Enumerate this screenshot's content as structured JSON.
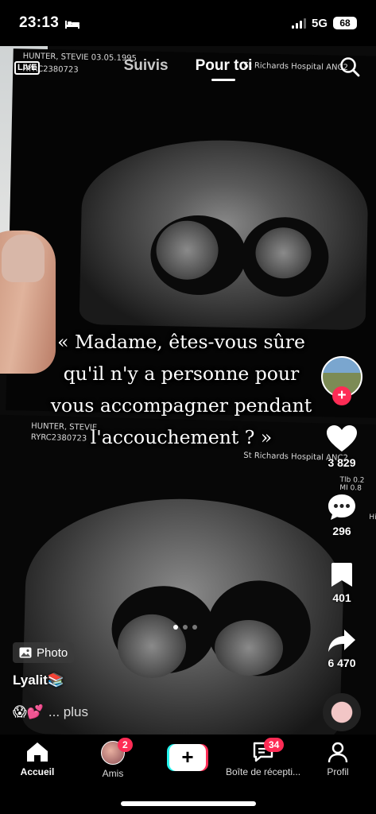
{
  "status": {
    "time": "23:13",
    "network": "5G",
    "battery": "68"
  },
  "topnav": {
    "live": "LIVE",
    "tabs": [
      "Suivis",
      "Pour toi"
    ],
    "active_tab": "Pour toi"
  },
  "scan": {
    "patient": "HUNTER, STEVIE  03.05.1995",
    "id": "RYRC2380723",
    "hospital": "St Richards Hospital ANC2",
    "patient2": "HUNTER, STEVIE",
    "hospital2": "St Richards Hospital ANC2",
    "side_stats": "Tlb 0.2\nMI 0.8",
    "side_label": "Hi"
  },
  "caption": {
    "lines": [
      "« Madame, êtes-vous sûre",
      "qu'il n'y a personne pour",
      "vous accompagner pendant",
      "l'accouchement ? »"
    ]
  },
  "rail": {
    "likes": "3 829",
    "comments": "296",
    "saves": "401",
    "shares": "6 470"
  },
  "post": {
    "photo_chip": "Photo",
    "username": "Lyalit📚",
    "description_emojis": "😱💕",
    "more": "... plus",
    "carousel": {
      "count": 3,
      "active": 0
    }
  },
  "tabbar": {
    "home": "Accueil",
    "friends": "Amis",
    "friends_badge": "2",
    "inbox": "Boîte de récepti...",
    "inbox_badge": "34",
    "profile": "Profil"
  },
  "colors": {
    "accent": "#fe2c55",
    "cyan": "#25f4ee",
    "background": "#000000"
  }
}
